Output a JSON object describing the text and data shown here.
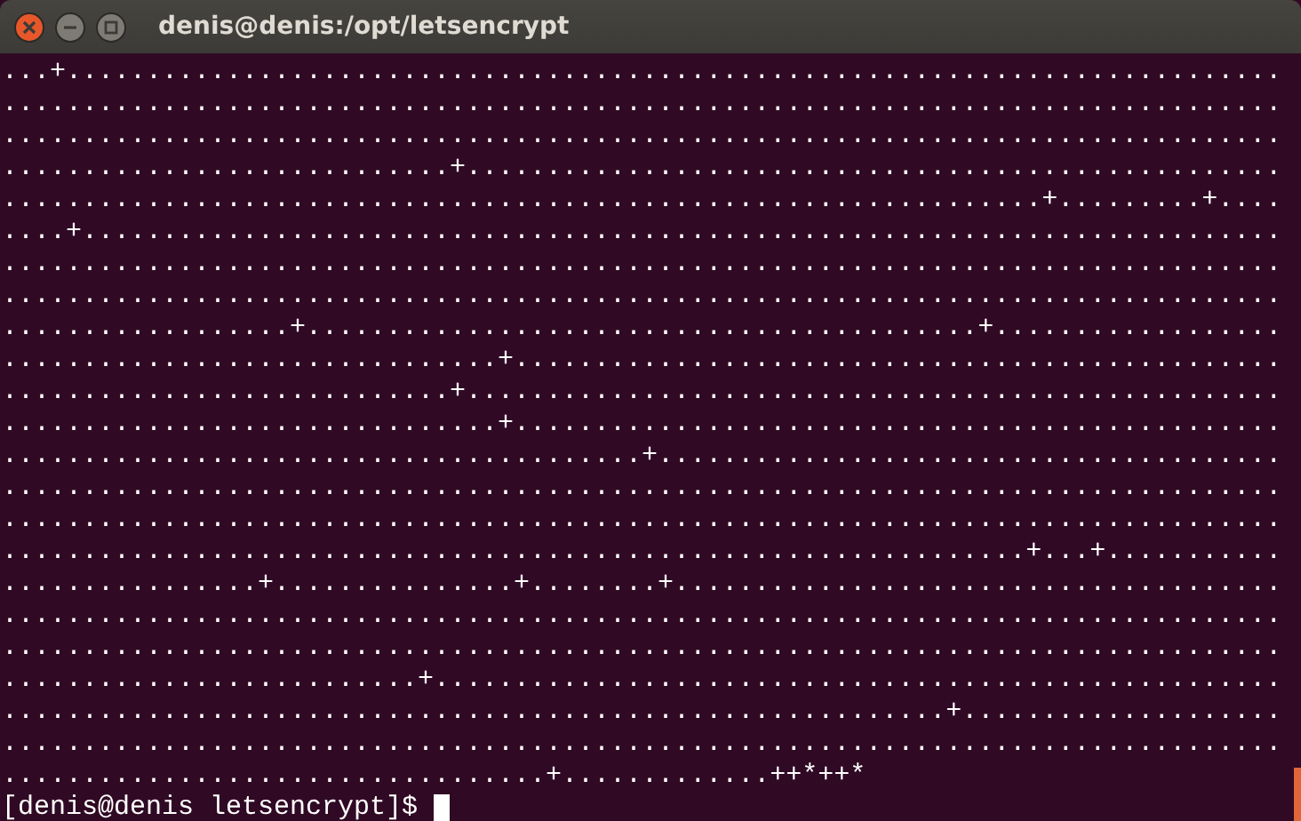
{
  "window": {
    "title": "denis@denis:/opt/letsencrypt"
  },
  "terminal": {
    "lines": [
      "...+............................................................................",
      "................................................................................",
      "................................................................................",
      "............................+...................................................",
      ".................................................................+.........+....",
      "....+...........................................................................",
      "................................................................................",
      "................................................................................",
      "..................+..........................................+..................",
      "...............................+................................................",
      "............................+...................................................",
      "...............................+................................................",
      "........................................+.......................................",
      "................................................................................",
      "................................................................................",
      "................................................................+...+...........",
      "................+...............+........+......................................",
      "................................................................................",
      "................................................................................",
      "..........................+.....................................................",
      "...........................................................+....................",
      "................................................................................",
      "..................................+.............++*++*"
    ],
    "prompt": "[denis@denis letsencrypt]$"
  }
}
